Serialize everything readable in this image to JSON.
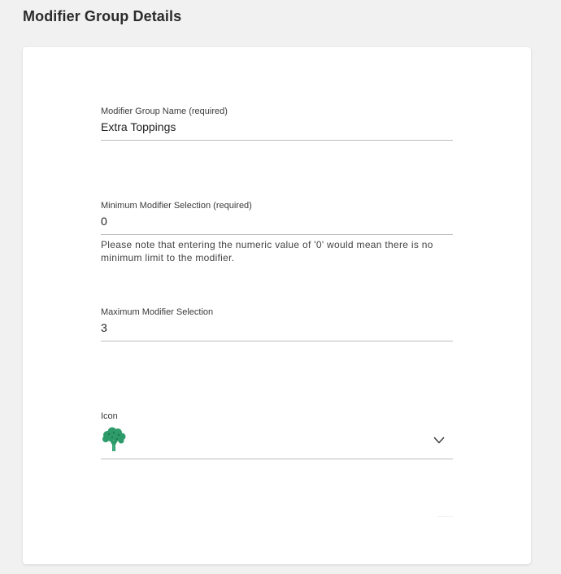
{
  "page": {
    "title": "Modifier Group Details"
  },
  "form": {
    "group_name": {
      "label": "Modifier Group Name (required)",
      "value": "Extra Toppings"
    },
    "min_selection": {
      "label": "Minimum Modifier Selection (required)",
      "value": "0",
      "helper": "Please note that entering the numeric value of '0' would mean there is no minimum limit to the modifier."
    },
    "max_selection": {
      "label": "Maximum Modifier Selection",
      "value": "3"
    },
    "icon": {
      "label": "Icon",
      "selected_icon": "broccoli-icon",
      "icon_color": "#2e9b6a"
    }
  }
}
